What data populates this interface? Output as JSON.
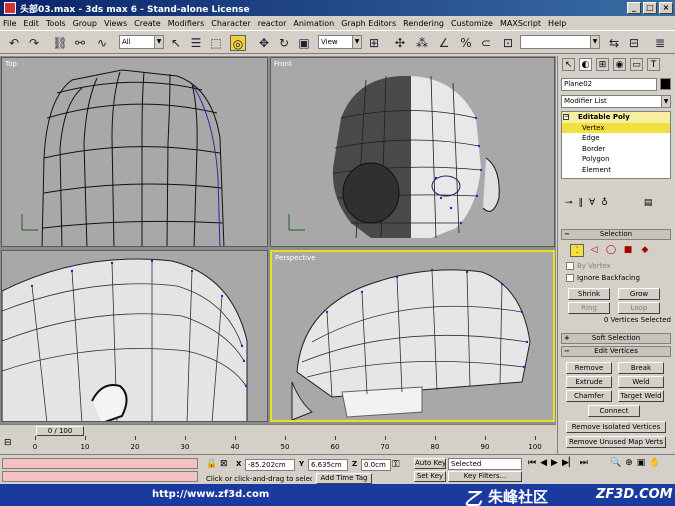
{
  "window": {
    "title": "头部03.max - 3ds max 6 - Stand-alone License",
    "controls": [
      "_",
      "□",
      "×"
    ]
  },
  "menu": [
    "File",
    "Edit",
    "Tools",
    "Group",
    "Views",
    "Create",
    "Modifiers",
    "Character",
    "reactor",
    "Animation",
    "Graph Editors",
    "Rendering",
    "Customize",
    "MAXScript",
    "Help"
  ],
  "toolbar": {
    "selection_filter": "All",
    "ref_coord": "View",
    "named_selection": ""
  },
  "viewports": {
    "top_label": "Top",
    "front_label": "Front",
    "left_label": "",
    "perspective_label": "Perspective"
  },
  "command_panel": {
    "object_name": "Plane02",
    "object_color": "#000000",
    "modifier_list": "Modifier List",
    "stack": {
      "head": "Editable Poly",
      "expand_glyph": "−",
      "items": [
        "Vertex",
        "Edge",
        "Border",
        "Polygon",
        "Element"
      ]
    },
    "selection_rollout": "Selection",
    "rollout_sign_minus": "−",
    "rollout_sign_plus": "+",
    "by_vertex": "By Vertex",
    "ignore_backfacing": "Ignore Backfacing",
    "shrink": "Shrink",
    "grow": "Grow",
    "ring": "Ring",
    "loop": "Loop",
    "selection_status": "0 Vertices Selected",
    "soft_selection_rollout": "Soft Selection",
    "edit_vertices_rollout": "Edit Vertices",
    "remove": "Remove",
    "break": "Break",
    "extrude": "Extrude",
    "weld": "Weld",
    "chamfer": "Chamfer",
    "target_weld": "Target Weld",
    "connect": "Connect",
    "remove_isolated": "Remove Isolated Vertices",
    "remove_unused": "Remove Unused Map Verts"
  },
  "timeline": {
    "current": "0 / 100",
    "ticks": [
      "0",
      "10",
      "20",
      "30",
      "40",
      "50",
      "60",
      "70",
      "80",
      "90",
      "100"
    ]
  },
  "status": {
    "x_label": "X",
    "x": "-85.202cm",
    "y_label": "Y",
    "y": "6.635cm",
    "z_label": "Z",
    "z": "0.0cm",
    "auto_key": "Auto Key",
    "set_key": "Set Key",
    "selected": "Selected",
    "key_filters": "Key Filters...",
    "add_time_tag": "Add Time Tag",
    "prompt": "Click or click-and-drag to select ob"
  },
  "watermark": {
    "url": "http://www.zf3d.com",
    "cn": "朱峰社区",
    "en": "ZF3D.COM"
  }
}
